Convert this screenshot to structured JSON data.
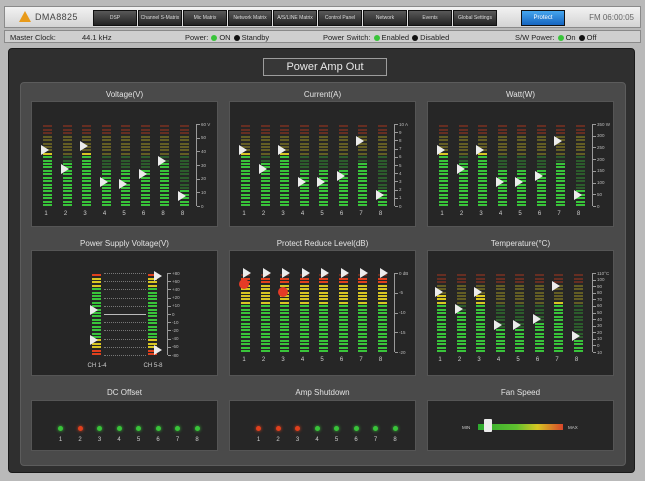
{
  "app": {
    "brand": "DMA8825",
    "fm": "FM 06:00:05"
  },
  "tabs": [
    {
      "label": "DSP",
      "active": false
    },
    {
      "label": "Channel S-Matrix",
      "active": false
    },
    {
      "label": "Mic Matrix",
      "active": false
    },
    {
      "label": "Network Matrix",
      "active": false
    },
    {
      "label": "A/S/LINE Matrix",
      "active": false
    },
    {
      "label": "Control Panel",
      "active": false
    },
    {
      "label": "Network",
      "active": false
    },
    {
      "label": "Events",
      "active": false
    },
    {
      "label": "Global Settings",
      "active": false
    },
    {
      "label": "Protect",
      "active": true
    }
  ],
  "status": {
    "master_clock_label": "Master Clock:",
    "master_clock_value": "44.1 kHz",
    "power_label": "Power:",
    "power_on": "ON",
    "power_standby": "Standby",
    "power_switch_label": "Power Switch:",
    "power_switch_enabled": "Enabled",
    "power_switch_disabled": "Disabled",
    "sw_power_label": "S/W Power:",
    "sw_power_on": "On",
    "sw_power_off": "Off"
  },
  "page_title": "Power Amp Out",
  "colors": {
    "green": "#39c43a",
    "yellow": "#d8c623",
    "red": "#e0401d",
    "accent": "#1f7fd6"
  },
  "panels": {
    "voltage": {
      "title": "Voltage(V)",
      "scale_labels": [
        "60 V",
        "50",
        "40",
        "30",
        "20",
        "10",
        "0"
      ],
      "channels": [
        "1",
        "2",
        "3",
        "4",
        "5",
        "6",
        "8",
        "8"
      ],
      "levels": [
        0.64,
        0.53,
        0.64,
        0.43,
        0.43,
        0.43,
        0.53,
        0.18
      ],
      "handles": [
        0.68,
        0.45,
        0.73,
        0.29,
        0.27,
        0.39,
        0.55,
        0.12
      ]
    },
    "current": {
      "title": "Current(A)",
      "scale_labels": [
        "10 A",
        "9",
        "8",
        "7",
        "6",
        "5",
        "4",
        "3",
        "2",
        "1",
        "0"
      ],
      "channels": [
        "1",
        "2",
        "3",
        "4",
        "5",
        "6",
        "7",
        "8"
      ],
      "levels": [
        0.64,
        0.53,
        0.64,
        0.43,
        0.43,
        0.43,
        0.53,
        0.18
      ],
      "handles": [
        0.68,
        0.45,
        0.68,
        0.29,
        0.29,
        0.37,
        0.79,
        0.14
      ]
    },
    "watt": {
      "title": "Watt(W)",
      "scale_labels": [
        "350 W",
        "300",
        "250",
        "200",
        "150",
        "100",
        "50",
        "0"
      ],
      "channels": [
        "1",
        "2",
        "3",
        "4",
        "5",
        "6",
        "7",
        "8"
      ],
      "levels": [
        0.64,
        0.53,
        0.64,
        0.43,
        0.43,
        0.43,
        0.53,
        0.18
      ],
      "handles": [
        0.68,
        0.45,
        0.68,
        0.29,
        0.29,
        0.37,
        0.79,
        0.14
      ]
    },
    "supply": {
      "title": "Power Supply Voltage(V)",
      "scale_labels": [
        "+80",
        "+60",
        "+40",
        "+20",
        "+10",
        "0",
        "-10",
        "-20",
        "-40",
        "-60",
        "-80"
      ],
      "channels": [
        "CH 1-4",
        "CH 5-8"
      ]
    },
    "protect": {
      "title": "Protect Reduce Level(dB)",
      "scale_labels": [
        "0 dB",
        "-5",
        "-10",
        "-15",
        "-20"
      ],
      "channels": [
        "1",
        "2",
        "3",
        "4",
        "5",
        "6",
        "7",
        "8"
      ],
      "levels": [
        0.95,
        0.95,
        0.95,
        0.95,
        0.95,
        0.95,
        0.95,
        0.95
      ]
    },
    "temperature": {
      "title": "Temperature(°C)",
      "scale_labels": [
        "110°C",
        "100",
        "90",
        "80",
        "70",
        "60",
        "50",
        "40",
        "30",
        "20",
        "10",
        "0",
        "10"
      ],
      "channels": [
        "1",
        "2",
        "3",
        "4",
        "5",
        "6",
        "7",
        "8"
      ],
      "levels": [
        0.72,
        0.5,
        0.72,
        0.3,
        0.3,
        0.38,
        0.64,
        0.14
      ],
      "handles": [
        0.76,
        0.55,
        0.76,
        0.34,
        0.34,
        0.42,
        0.83,
        0.2
      ]
    },
    "dc_offset": {
      "title": "DC Offset",
      "channels": [
        "1",
        "2",
        "3",
        "4",
        "5",
        "6",
        "7",
        "8"
      ],
      "states": [
        "green",
        "red",
        "green",
        "green",
        "green",
        "green",
        "green",
        "green"
      ]
    },
    "amp_shutdown": {
      "title": "Amp Shutdown",
      "channels": [
        "1",
        "2",
        "3",
        "4",
        "5",
        "6",
        "7",
        "8"
      ],
      "states": [
        "red",
        "red",
        "red",
        "green",
        "green",
        "green",
        "green",
        "green"
      ]
    },
    "fan_speed": {
      "title": "Fan Speed",
      "min_label": "MIN",
      "max_label": "MAX",
      "level": 0.12
    }
  }
}
